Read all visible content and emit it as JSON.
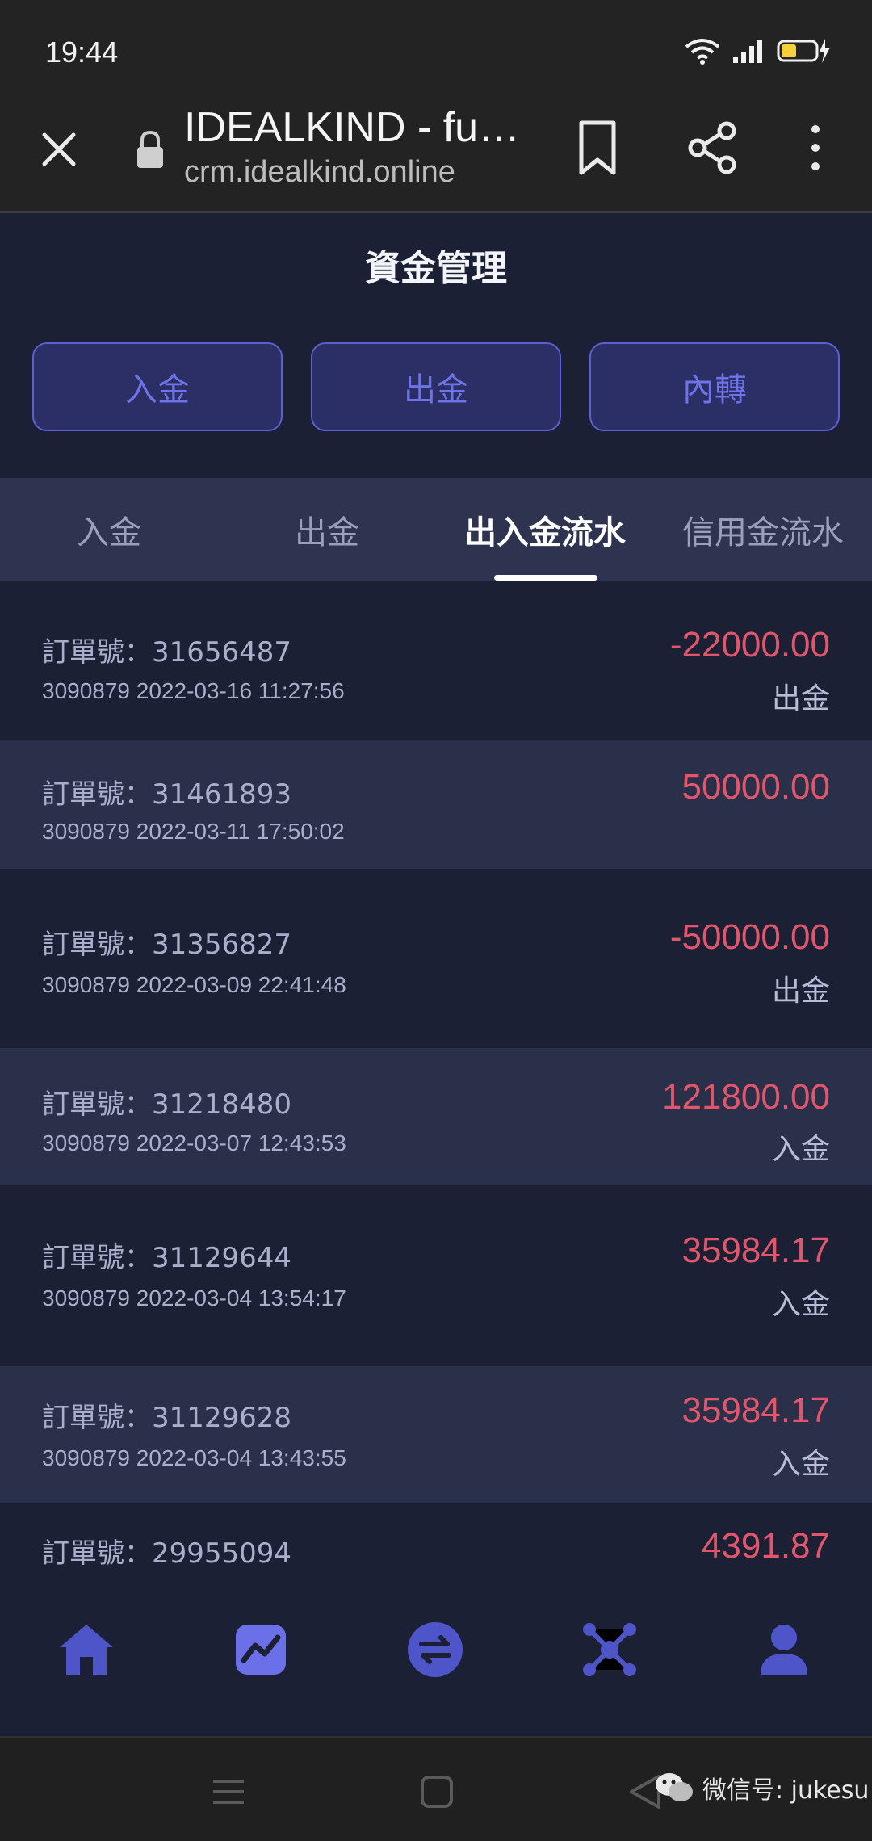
{
  "status_bar": {
    "time": "19:44"
  },
  "browser": {
    "tab_title": "IDEALKIND - fu…",
    "url": "crm.idealkind.online"
  },
  "page": {
    "title": "資金管理",
    "actions": [
      "入金",
      "出金",
      "內轉"
    ],
    "tabs": [
      {
        "label": "入金",
        "active": false
      },
      {
        "label": "出金",
        "active": false
      },
      {
        "label": "出入金流水",
        "active": true
      },
      {
        "label": "信用金流水",
        "active": false
      }
    ],
    "transactions": [
      {
        "order": "訂單號：31656487",
        "meta": "3090879 2022-03-16 11:27:56",
        "amount": "-22000.00",
        "type": "出金"
      },
      {
        "order": "訂單號：31461893",
        "meta": "3090879 2022-03-11 17:50:02",
        "amount": "50000.00",
        "type": ""
      },
      {
        "order": "訂單號：31356827",
        "meta": "3090879 2022-03-09 22:41:48",
        "amount": "-50000.00",
        "type": "出金"
      },
      {
        "order": "訂單號：31218480",
        "meta": "3090879 2022-03-07 12:43:53",
        "amount": "121800.00",
        "type": "入金"
      },
      {
        "order": "訂單號：31129644",
        "meta": "3090879 2022-03-04 13:54:17",
        "amount": "35984.17",
        "type": "入金"
      },
      {
        "order": "訂單號：31129628",
        "meta": "3090879 2022-03-04 13:43:55",
        "amount": "35984.17",
        "type": "入金"
      },
      {
        "order": "訂單號：29955094",
        "meta": "",
        "amount": "4391.87",
        "type": ""
      }
    ]
  },
  "bottom_nav": {
    "items": [
      {
        "icon": "home-icon",
        "active": false
      },
      {
        "icon": "chart-icon",
        "active": true
      },
      {
        "icon": "transfer-icon",
        "active": false
      },
      {
        "icon": "network-icon",
        "active": false
      },
      {
        "icon": "user-icon",
        "active": false
      }
    ]
  },
  "watermark": {
    "text": "微信号: jukesu"
  },
  "colors": {
    "accent": "#5b5fd2",
    "negative": "#e2566c",
    "background": "#1b2035",
    "row_alt": "#2a2f4a"
  }
}
